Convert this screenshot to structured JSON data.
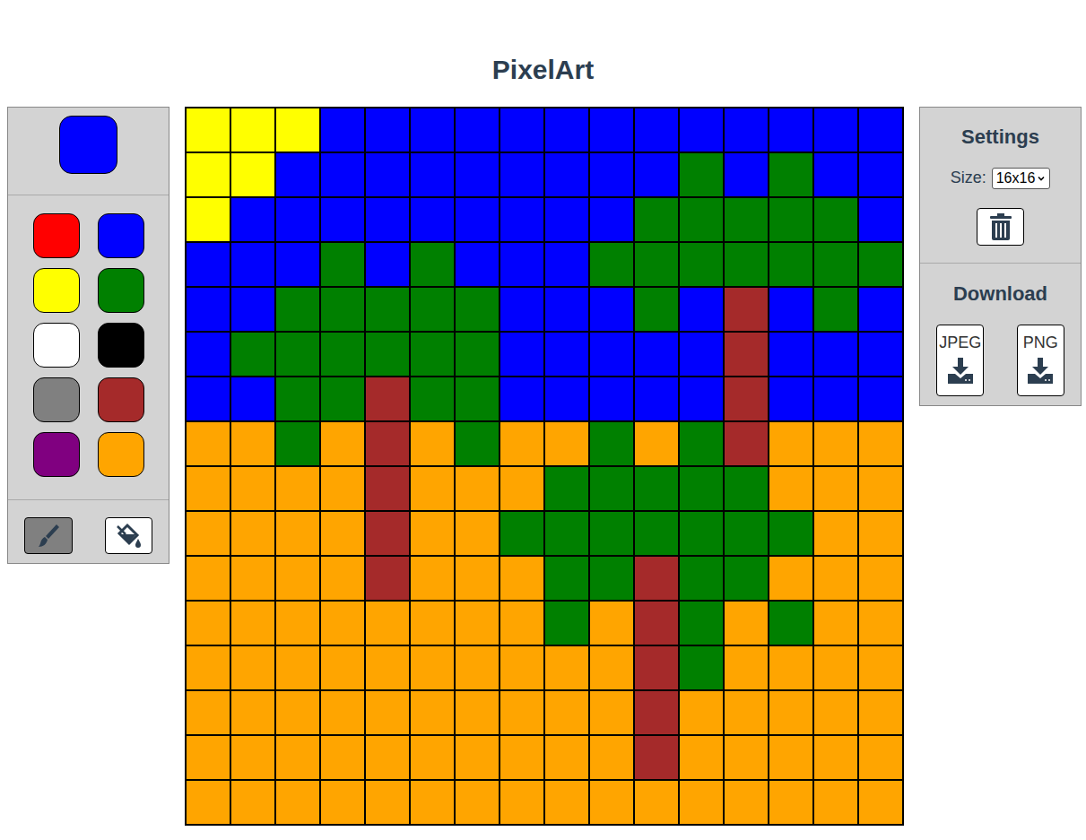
{
  "title": "PixelArt",
  "current_color": "#0000ff",
  "palette": [
    {
      "color": "#ff0000"
    },
    {
      "color": "#0000ff"
    },
    {
      "color": "#ffff00"
    },
    {
      "color": "#008000"
    },
    {
      "color": "#ffffff"
    },
    {
      "color": "#000000"
    },
    {
      "color": "#808080"
    },
    {
      "color": "#a52a2a"
    },
    {
      "color": "#800080"
    },
    {
      "color": "#ffa500"
    }
  ],
  "tools": [
    {
      "kind": "brush",
      "selected": true
    },
    {
      "kind": "fill",
      "selected": false
    }
  ],
  "settings": {
    "title": "Settings",
    "size_label": "Size:",
    "size_value": "16x16"
  },
  "download": {
    "title": "Download",
    "buttons": [
      {
        "label": "JPEG"
      },
      {
        "label": "PNG"
      }
    ]
  },
  "canvas": {
    "legend": {
      "Y": "#ffff00",
      "B": "#0000ff",
      "G": "#008000",
      "R": "#a52a2a",
      "O": "#ffa500"
    },
    "rows": [
      "YYYBBBBBBBBBBBBB",
      "YYBBBBBBBBBGBGBB",
      "YBBBBBBBBBGGGGGB",
      "BBBGBGBBBGGGGGGG",
      "BBGGGGGBBBGBRBGB",
      "BGGGGGGBBBBBRBBB",
      "BBGGRGGBBBBBRBBB",
      "OOGOROGOOGOGROOO",
      "OOOOROOOGGGGGOOO",
      "OOOOROOGGGGGGGOO",
      "OOOOROOOGGRGGOOO",
      "OOOOOOOOGORGOGOO",
      "OOOOOOOOOORGOOOO",
      "OOOOOOOOOOROOOOO",
      "OOOOOOOOOOROOOOO",
      "OOOOOOOOOOOOOOOO"
    ]
  }
}
